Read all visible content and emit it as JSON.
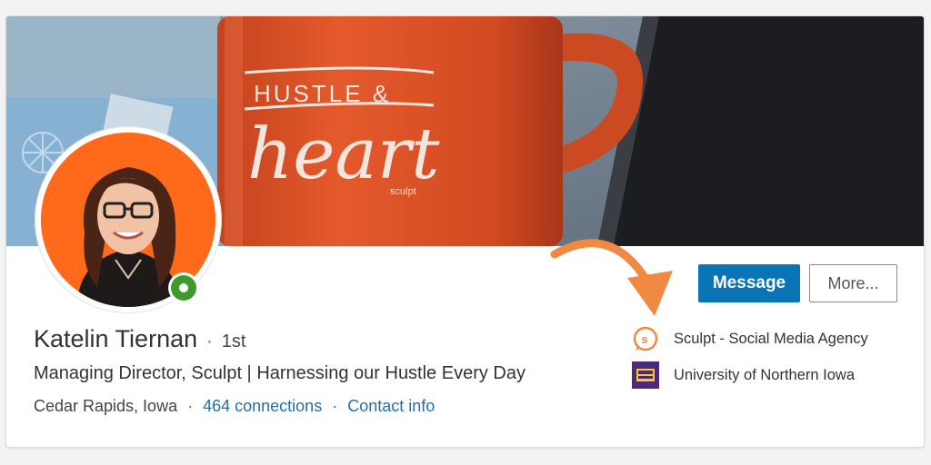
{
  "profile": {
    "name": "Katelin Tiernan",
    "separator": "·",
    "degree": "1st",
    "headline": "Managing Director, Sculpt | Harnessing our Hustle Every Day",
    "location": "Cedar Rapids, Iowa",
    "meta_separator": "·",
    "connections": "464 connections",
    "contact_info": "Contact info"
  },
  "actions": {
    "message_label": "Message",
    "more_label": "More..."
  },
  "organizations": [
    {
      "label": "Sculpt - Social Media Agency",
      "icon": "sculpt-logo-icon"
    },
    {
      "label": "University of Northern Iowa",
      "icon": "uni-logo-icon"
    }
  ],
  "cover": {
    "mug_line1": "HUSTLE &",
    "mug_line2": "heart",
    "mug_brand": "sculpt"
  },
  "colors": {
    "primary_button": "#0a74b6",
    "link": "#1f6fb5",
    "online": "#3f9a2c",
    "arrow": "#f08a43",
    "mug": "#e0552a",
    "uni_purple": "#4b2a7b",
    "uni_gold": "#ffc62b"
  }
}
